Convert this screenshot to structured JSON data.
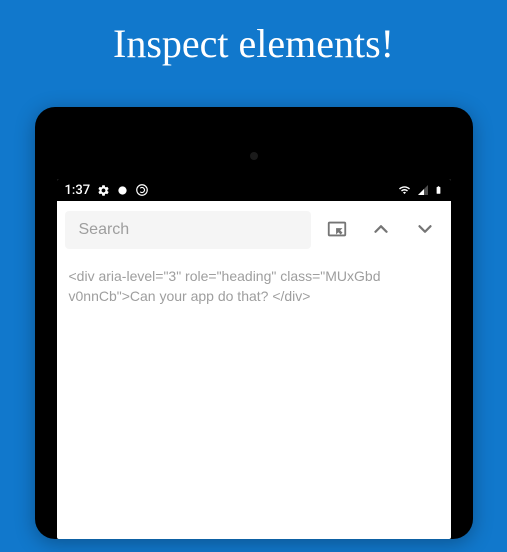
{
  "headline": "Inspect elements!",
  "statusBar": {
    "time": "1:37"
  },
  "toolbar": {
    "searchPlaceholder": "Search"
  },
  "content": {
    "html": "<div aria-level=\"3\" role=\"heading\" class=\"MUxGbd v0nnCb\">Can your app do that? </div>"
  }
}
